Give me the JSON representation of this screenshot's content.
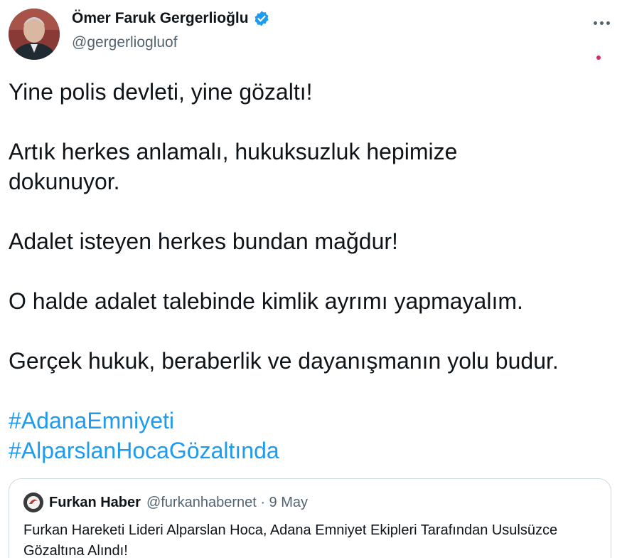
{
  "author": {
    "display_name": "Ömer Faruk Gergerlioğlu",
    "handle": "@gergerliogluof",
    "verified_icon": "verified-badge-icon",
    "avatar_icon": "profile-photo"
  },
  "menu": {
    "more_icon": "more-options-icon"
  },
  "tweet": {
    "paragraphs": [
      "Yine polis devleti, yine gözaltı!",
      "Artık herkes anlamalı, hukuksuzluk hepimize dokunuyor.",
      "Adalet isteyen herkes bundan mağdur!",
      "O halde adalet talebinde kimlik ayrımı yapmayalım.",
      "Gerçek hukuk, beraberlik ve dayanışmanın yolu budur."
    ],
    "hashtags": [
      "#AdanaEmniyeti",
      "#AlparslanHocaGözaltında"
    ]
  },
  "quoted_tweet": {
    "display_name": "Furkan Haber",
    "meta": "@furkanhabernet · 9 May",
    "text": "Furkan Hareketi Lideri Alparslan Hoca, Adana Emniyet Ekipleri Tarafından Usulsüzce Gözaltına Alındı!"
  },
  "colors": {
    "link": "#1d9bf0",
    "secondary_text": "#536471",
    "border": "#cfd9de",
    "notification_dot": "#e0245e"
  }
}
